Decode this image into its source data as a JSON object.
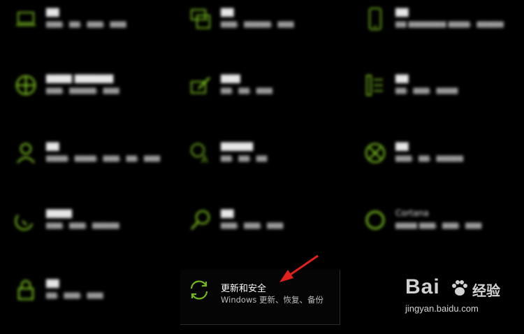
{
  "accent_color": "#74b61e",
  "tiles": [
    {
      "id": "system",
      "icon": "laptop-icon"
    },
    {
      "id": "devices",
      "icon": "keyboard-devices-icon"
    },
    {
      "id": "phone",
      "icon": "phone-icon"
    },
    {
      "id": "network",
      "icon": "globe-icon"
    },
    {
      "id": "personalization",
      "icon": "brush-icon"
    },
    {
      "id": "apps",
      "icon": "apps-list-icon"
    },
    {
      "id": "accounts",
      "icon": "person-icon"
    },
    {
      "id": "time-language",
      "icon": "time-language-icon"
    },
    {
      "id": "gaming",
      "icon": "xbox-icon"
    },
    {
      "id": "ease-of-access",
      "icon": "ease-of-access-icon"
    },
    {
      "id": "search",
      "icon": "search-icon"
    },
    {
      "id": "cortana",
      "icon": "cortana-icon",
      "title": "Cortana"
    },
    {
      "id": "privacy",
      "icon": "lock-icon"
    }
  ],
  "update_security": {
    "icon": "sync-arrows-icon",
    "title": "更新和安全",
    "desc": "Windows 更新、恢复、备份"
  },
  "watermark": {
    "brand": "Bai",
    "brand_suffix": "经验",
    "url": "jingyan.baidu.com"
  }
}
